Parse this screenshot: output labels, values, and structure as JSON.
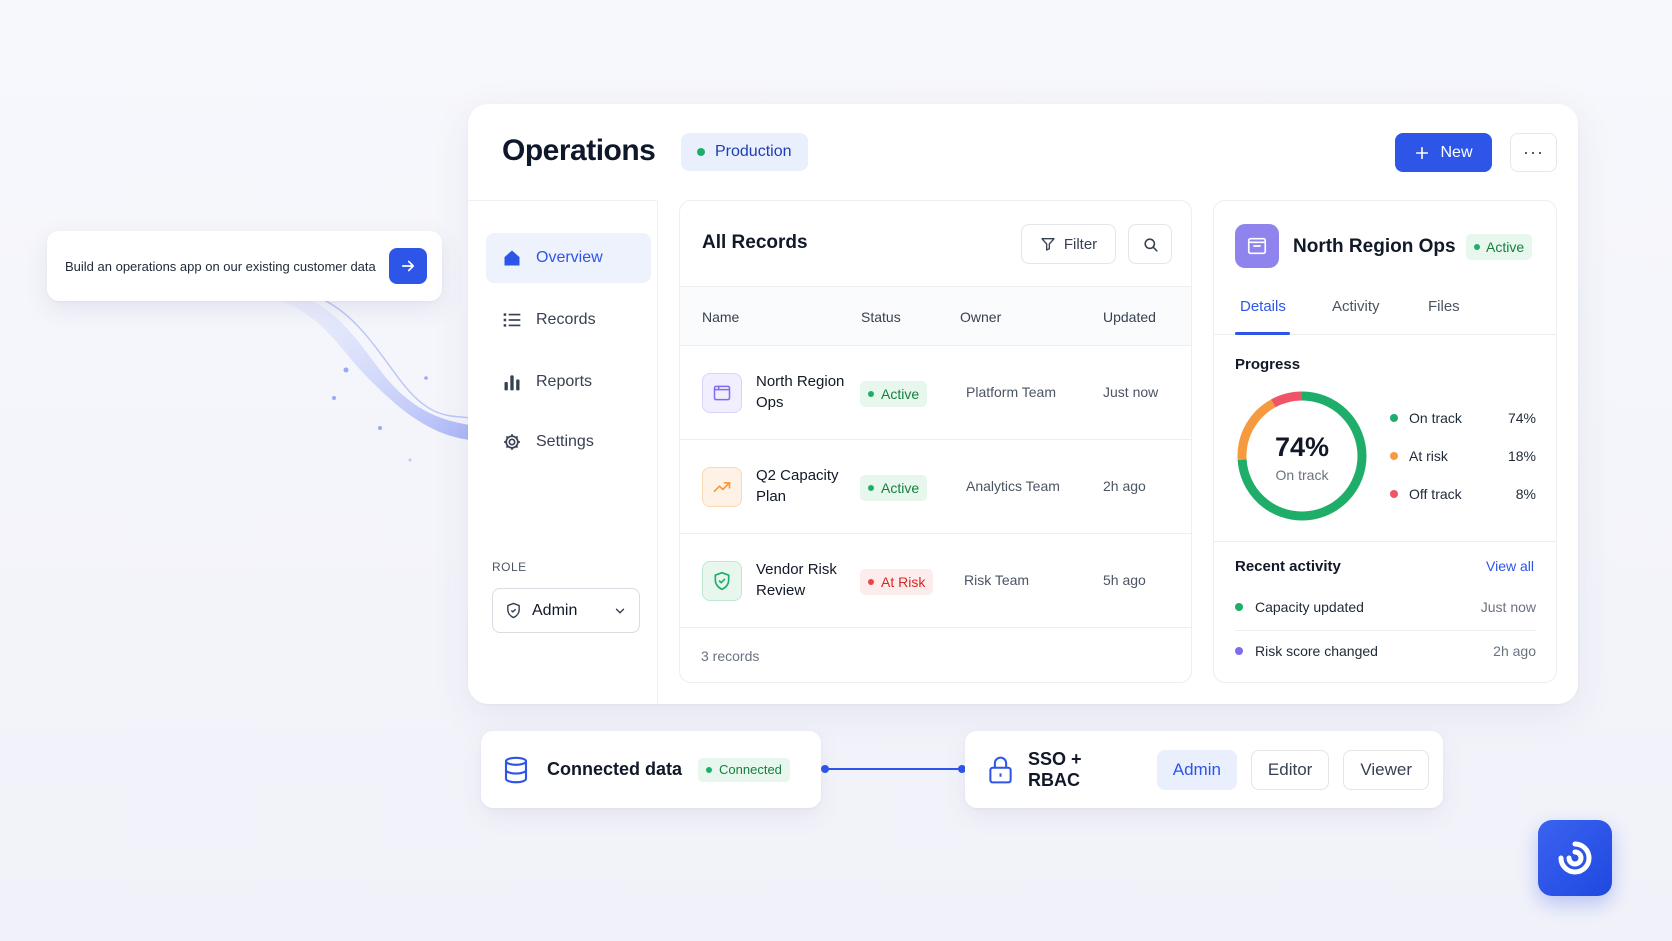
{
  "prompt": {
    "text": "Build an operations app on our existing customer data",
    "submit_icon": "arrow-right-icon"
  },
  "header": {
    "title": "Operations",
    "environment": "Production",
    "new_label": "New",
    "more_icon": "ellipsis-icon"
  },
  "sidebar": {
    "items": [
      {
        "label": "Overview",
        "icon": "home-icon",
        "active": true
      },
      {
        "label": "Records",
        "icon": "list-icon",
        "active": false
      },
      {
        "label": "Reports",
        "icon": "bar-chart-icon",
        "active": false
      },
      {
        "label": "Settings",
        "icon": "gear-icon",
        "active": false
      }
    ],
    "role_label": "ROLE",
    "role_value": "Admin"
  },
  "records": {
    "title": "All Records",
    "filter_label": "Filter",
    "columns": [
      "Name",
      "Status",
      "Owner",
      "Updated"
    ],
    "rows": [
      {
        "name": "North Region Ops",
        "status": "Active",
        "owner": "Platform Team",
        "updated": "Just now",
        "icon": "folder-icon"
      },
      {
        "name": "Q2 Capacity Plan",
        "status": "Active",
        "owner": "Analytics Team",
        "updated": "2h ago",
        "icon": "trend-up-icon"
      },
      {
        "name": "Vendor Risk Review",
        "status": "At Risk",
        "owner": "Risk Team",
        "updated": "5h ago",
        "icon": "shield-check-icon"
      }
    ],
    "count_text": "3 records"
  },
  "detail": {
    "title": "North Region Ops",
    "status": "Active",
    "tabs": [
      "Details",
      "Activity",
      "Files"
    ],
    "active_tab": "Details",
    "progress_label": "Progress",
    "progress": {
      "percent_text": "74%",
      "subtitle": "On track",
      "segments": [
        {
          "label": "On track",
          "value": 74,
          "value_text": "74%",
          "color": "#1fae6a"
        },
        {
          "label": "At risk",
          "value": 18,
          "value_text": "18%",
          "color": "#f59a3e"
        },
        {
          "label": "Off track",
          "value": 8,
          "value_text": "8%",
          "color": "#ef5566"
        }
      ]
    },
    "recent_label": "Recent activity",
    "view_all": "View all",
    "activity": [
      {
        "text": "Capacity updated",
        "time": "Just now",
        "color": "#1fae6a"
      },
      {
        "text": "Risk score changed",
        "time": "2h ago",
        "color": "#7c6cf2"
      }
    ]
  },
  "connected": {
    "title": "Connected data",
    "status": "Connected",
    "icon": "database-icon"
  },
  "sso": {
    "title": "SSO + RBAC",
    "icon": "lock-icon",
    "roles": [
      "Admin",
      "Editor",
      "Viewer"
    ],
    "selected_role": "Admin"
  },
  "colors": {
    "accent": "#2d55e8",
    "success": "#15803d",
    "danger": "#dc2626",
    "detail_icon_bg": "#8f84ee"
  }
}
